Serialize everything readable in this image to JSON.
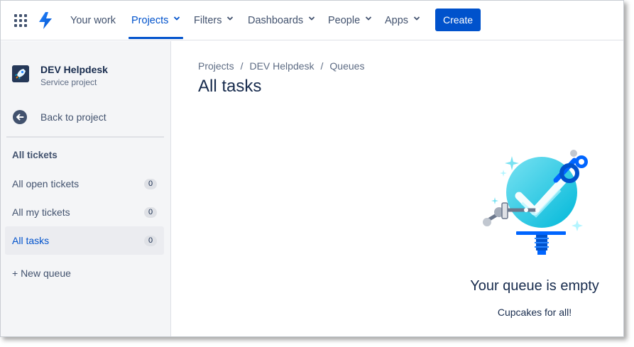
{
  "nav": {
    "items": [
      {
        "label": "Your work",
        "dropdown": false
      },
      {
        "label": "Projects",
        "dropdown": true,
        "active": true
      },
      {
        "label": "Filters",
        "dropdown": true
      },
      {
        "label": "Dashboards",
        "dropdown": true
      },
      {
        "label": "People",
        "dropdown": true
      },
      {
        "label": "Apps",
        "dropdown": true
      }
    ],
    "create_label": "Create",
    "app_switcher_icon": "grid-icon",
    "logo_icon": "jira-lightning-logo"
  },
  "sidebar": {
    "project_name": "DEV Helpdesk",
    "project_type": "Service project",
    "back_label": "Back to project",
    "section_heading": "All tickets",
    "queues": [
      {
        "label": "All open tickets",
        "count": "0",
        "active": false
      },
      {
        "label": "All my tickets",
        "count": "0",
        "active": false
      },
      {
        "label": "All tasks",
        "count": "0",
        "active": true
      }
    ],
    "new_queue_label": "+ New queue"
  },
  "main": {
    "breadcrumb": [
      "Projects",
      "DEV Helpdesk",
      "Queues"
    ],
    "breadcrumb_separator": "/",
    "title": "All tasks",
    "empty_title": "Your queue is empty",
    "empty_subtitle": "Cupcakes for all!"
  },
  "colors": {
    "brand_blue": "#0052cc",
    "text_primary": "#172b4d",
    "text_subtle": "#42526e",
    "sidebar_bg": "#f4f5f7",
    "illustration_cyan": "#4fcdf0"
  }
}
